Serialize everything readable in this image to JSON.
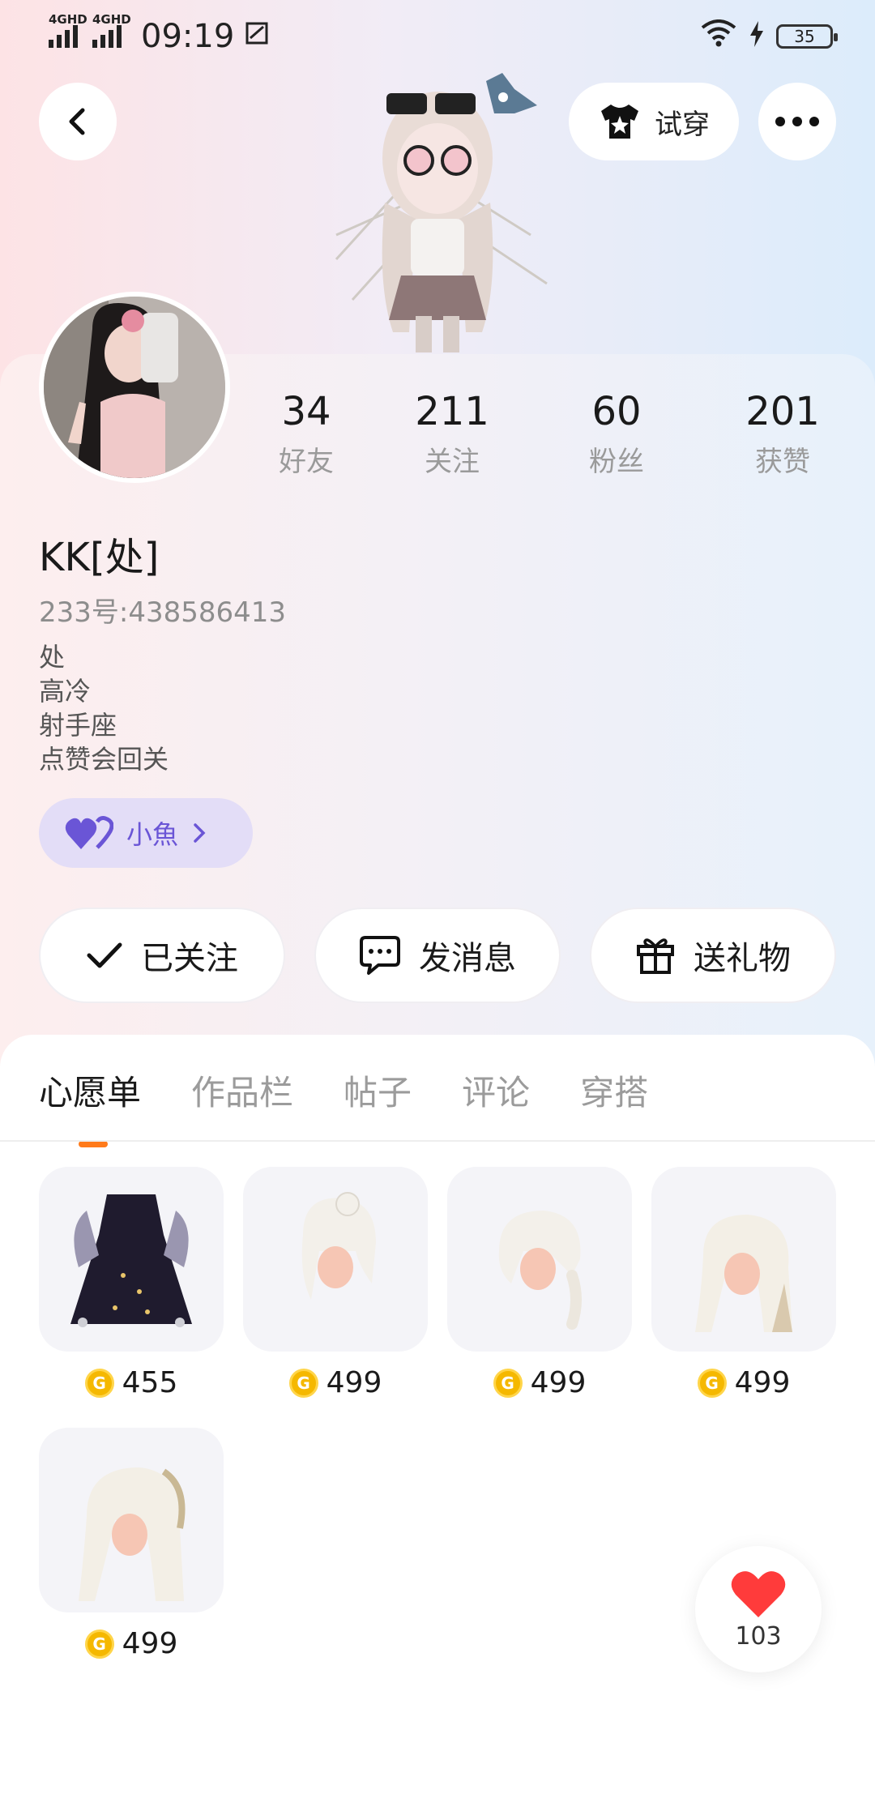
{
  "status_bar": {
    "signal1": "4GHD",
    "signal2": "4GHD",
    "time": "09:19",
    "battery": "35"
  },
  "header": {
    "try_on_label": "试穿"
  },
  "stats": [
    {
      "value": "34",
      "label": "好友"
    },
    {
      "value": "211",
      "label": "关注"
    },
    {
      "value": "60",
      "label": "粉丝"
    },
    {
      "value": "201",
      "label": "获赞"
    }
  ],
  "profile": {
    "nickname": "KK[处]",
    "uid": "233号:438586413",
    "bio": [
      "处",
      "高冷",
      "射手座",
      "点赞会回关"
    ],
    "fan_tag": "小魚"
  },
  "actions": {
    "follow": "已关注",
    "message": "发消息",
    "gift": "送礼物"
  },
  "tabs": [
    "心愿单",
    "作品栏",
    "帖子",
    "评论",
    "穿搭"
  ],
  "wishlist": [
    {
      "price": "455"
    },
    {
      "price": "499"
    },
    {
      "price": "499"
    },
    {
      "price": "499"
    },
    {
      "price": "499"
    }
  ],
  "like_count": "103",
  "colors": {
    "accent": "#ff7a1a",
    "fan_tag_bg": "#e3ddf7",
    "fan_tag_text": "#6a55d6",
    "coin": "#f5b800",
    "heart": "#ff3b3b"
  }
}
